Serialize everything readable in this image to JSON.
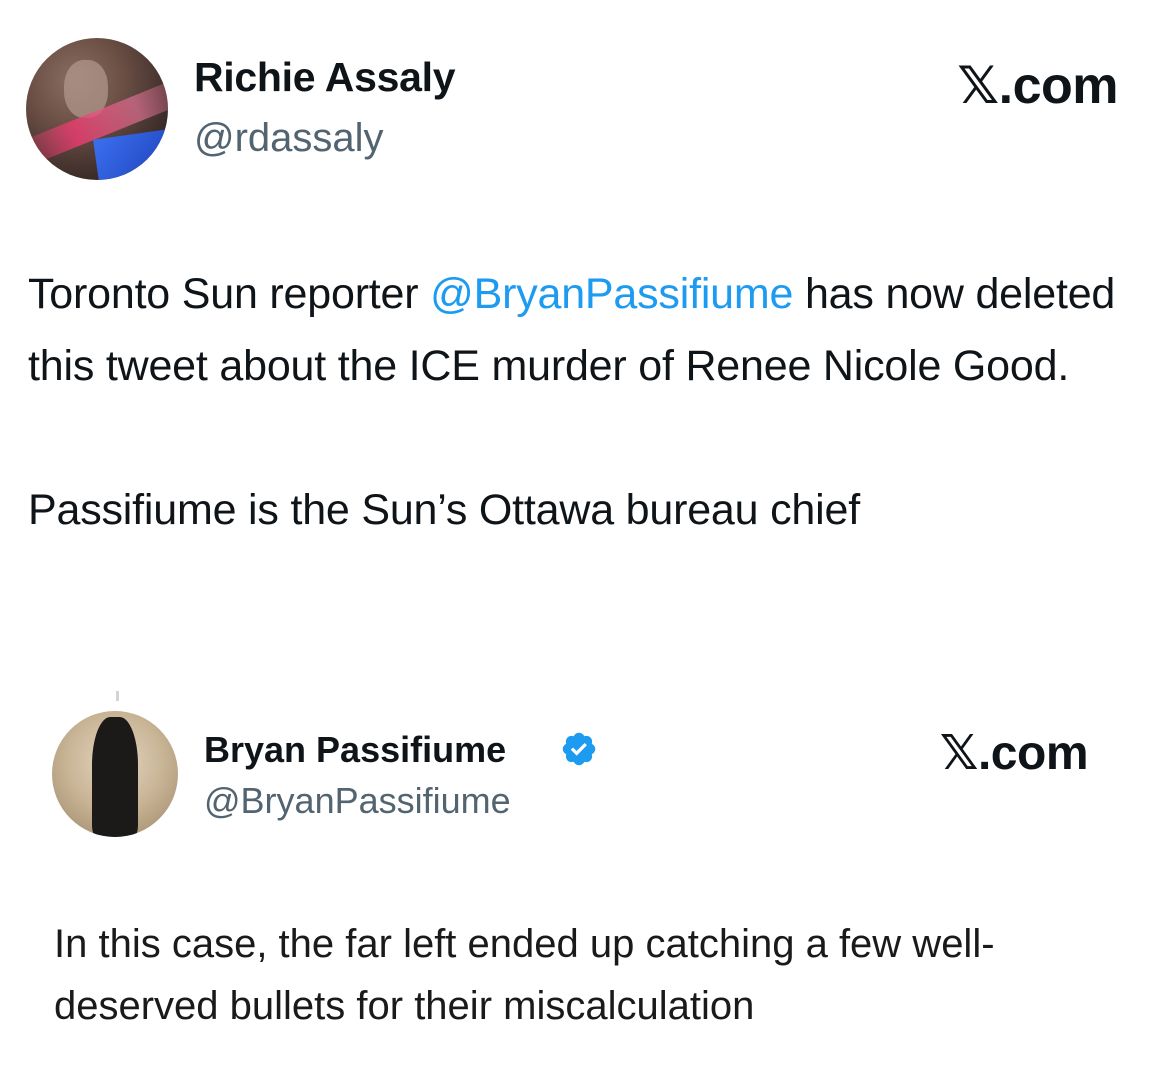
{
  "tweet": {
    "author_name": "Richie Assaly",
    "author_handle": "@rdassaly",
    "brand": "𝕏.com",
    "text_before_mention": "Toronto Sun reporter ",
    "mention": "@BryanPassifiume",
    "text_after_mention": " has now deleted this tweet about the ICE murder of Renee Nicole Good.",
    "text_second_paragraph": "Passifiume is the Sun’s Ottawa bureau chief"
  },
  "quoted_tweet": {
    "author_name": "Bryan Passifiume",
    "author_handle": "@BryanPassifiume",
    "verified": true,
    "brand": "𝕏.com",
    "text": "In this case, the far left ended up catching a few well-deserved bullets for their miscalculation"
  },
  "colors": {
    "mention": "#1d9bf0",
    "handle": "#536471",
    "verified_badge": "#1d9bf0",
    "text": "#0f1419"
  }
}
